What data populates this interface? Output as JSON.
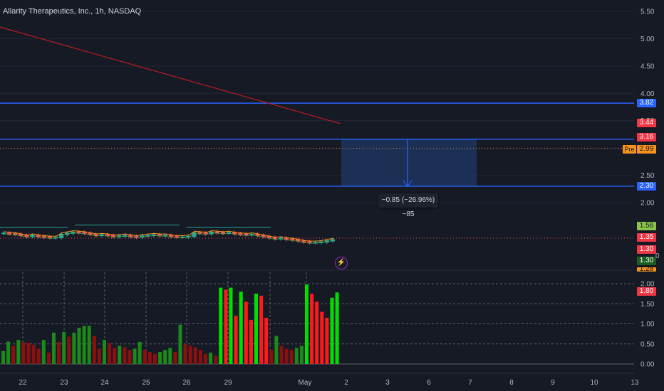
{
  "chart_title": "Allarity Therapeutics, Inc., 1h, NASDAQ",
  "measure_label": "−0.85 (−26.96%) −85",
  "pre_tag": "Pre",
  "flash_icon": "⚡",
  "edge_zero": "0",
  "colors": {
    "background": "#161a25",
    "horizontal_line": "#2962ff",
    "trend_line": "#b71c1c",
    "up_candle": "#26a69a",
    "down_candle": "#ef5350",
    "bright_green_bar": "#00e000",
    "dark_green_bar": "#1b8a1b",
    "bright_red_bar": "#ff1a1a",
    "dark_red_bar": "#8b1010",
    "measure_zone": "#1f3866"
  },
  "price_badges": {
    "b382": "3.82",
    "b344": "3.44",
    "b316": "3.16",
    "b299": "2.99",
    "b230": "2.30",
    "b156": "1.56",
    "b135": "1.35",
    "b130a": "1.30",
    "b130b": "1.30",
    "b128": "1.28",
    "b180": "1.80"
  },
  "chart_data": [
    {
      "type": "candlestick",
      "title": "Allarity Therapeutics, Inc., 1h, NASDAQ",
      "y_ticks": [
        "5.50",
        "5.00",
        "4.50",
        "4.00",
        "3.50",
        "3.00",
        "2.50",
        "2.00"
      ],
      "x_ticks": [
        "22",
        "23",
        "24",
        "25",
        "26",
        "29",
        "May",
        "2",
        "3",
        "6",
        "7",
        "8",
        "9",
        "10",
        "13"
      ],
      "horizontal_levels": [
        3.82,
        3.16,
        2.3
      ],
      "measure": {
        "from": 3.16,
        "to": 2.3,
        "change": -0.85,
        "percent": -26.96,
        "ticks": -85
      },
      "price_range_approx": [
        1.3,
        1.56
      ]
    },
    {
      "type": "bar",
      "y_ticks": [
        "2.00",
        "1.50",
        "1.00",
        "0.50",
        "0.00"
      ],
      "ylim": [
        0,
        2.2
      ],
      "last_value": 1.8,
      "values": [
        0.32,
        0.56,
        0.45,
        0.6,
        0.55,
        0.52,
        0.48,
        0.38,
        0.6,
        0.28,
        0.78,
        0.55,
        0.8,
        0.68,
        0.78,
        0.9,
        0.95,
        0.95,
        0.7,
        0.38,
        0.6,
        0.52,
        0.4,
        0.45,
        0.42,
        0.35,
        0.38,
        0.55,
        0.35,
        0.3,
        0.25,
        0.3,
        0.35,
        0.4,
        0.3,
        0.98,
        0.5,
        0.45,
        0.42,
        0.35,
        0.25,
        0.28,
        0.2,
        1.9,
        1.85,
        1.9,
        1.2,
        1.8,
        1.55,
        1.1,
        1.75,
        1.7,
        1.15,
        0.35,
        0.7,
        0.45,
        0.38,
        0.35,
        0.4,
        0.45,
        1.98,
        1.75,
        1.55,
        1.3,
        1.15,
        1.65,
        1.78
      ]
    }
  ]
}
